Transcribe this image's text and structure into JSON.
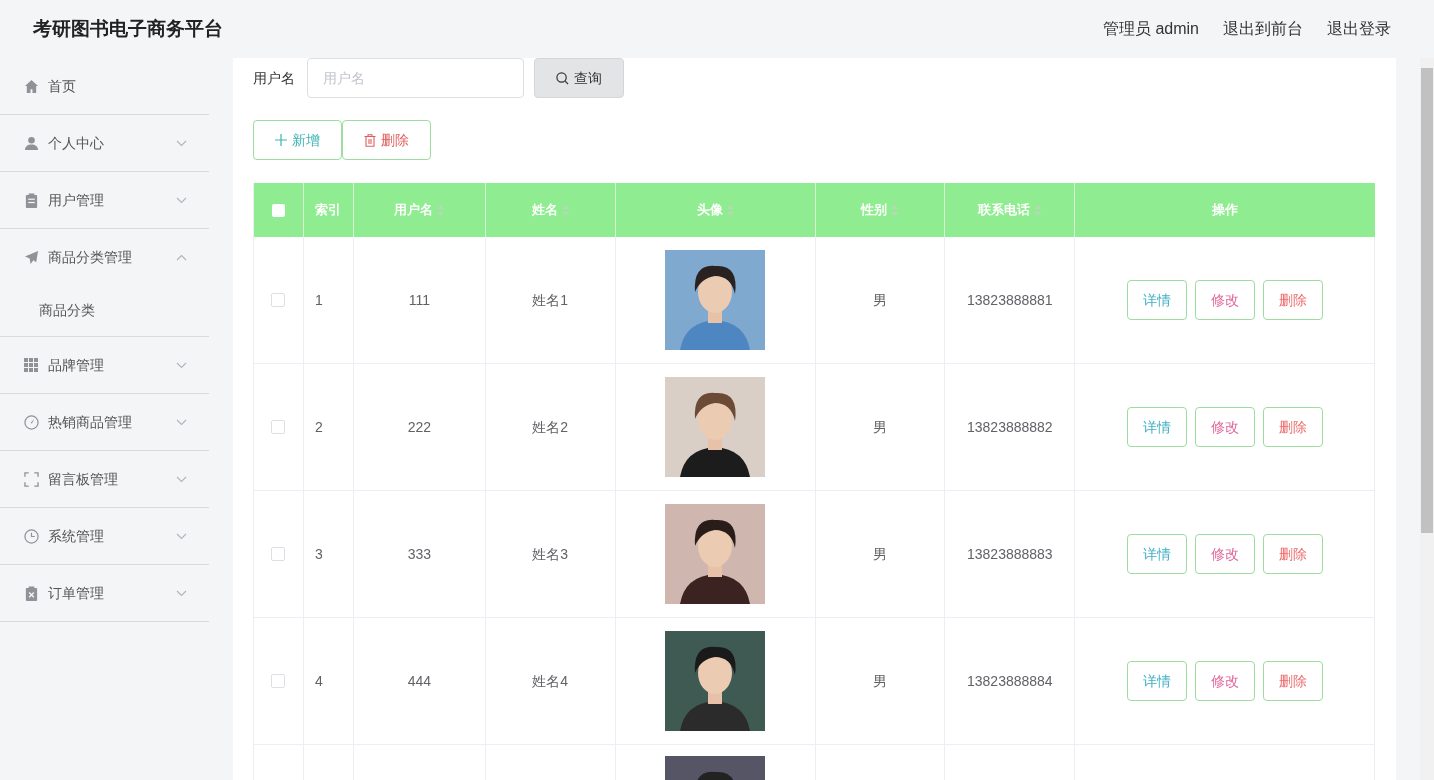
{
  "header": {
    "title": "考研图书电子商务平台",
    "links": [
      "管理员 admin",
      "退出到前台",
      "退出登录"
    ]
  },
  "sidebar": {
    "items": [
      {
        "label": "首页",
        "has_children": false
      },
      {
        "label": "个人中心",
        "expanded": false,
        "has_children": true
      },
      {
        "label": "用户管理",
        "expanded": false,
        "has_children": true
      },
      {
        "label": "商品分类管理",
        "expanded": true,
        "has_children": true,
        "children": [
          {
            "label": "商品分类"
          }
        ]
      },
      {
        "label": "品牌管理",
        "expanded": false,
        "has_children": true
      },
      {
        "label": "热销商品管理",
        "expanded": false,
        "has_children": true
      },
      {
        "label": "留言板管理",
        "expanded": false,
        "has_children": true
      },
      {
        "label": "系统管理",
        "expanded": false,
        "has_children": true
      },
      {
        "label": "订单管理",
        "expanded": false,
        "has_children": true
      }
    ]
  },
  "search": {
    "label": "用户名",
    "placeholder": "用户名",
    "button": "查询"
  },
  "actions": [
    {
      "label": "新增",
      "kind": "add"
    },
    {
      "label": "删除",
      "kind": "delete"
    }
  ],
  "table": {
    "all_checked": false,
    "columns": [
      {
        "label": "索引",
        "sortable": false
      },
      {
        "label": "用户名",
        "sortable": true
      },
      {
        "label": "姓名",
        "sortable": true
      },
      {
        "label": "头像",
        "sortable": true
      },
      {
        "label": "性别",
        "sortable": true
      },
      {
        "label": "联系电话",
        "sortable": true
      },
      {
        "label": "操作",
        "sortable": false
      }
    ],
    "rows": [
      {
        "index": "1",
        "username": "111",
        "name": "姓名1",
        "gender": "男",
        "phone": "13823888881",
        "checked": false,
        "buttons": [
          "详情",
          "修改",
          "删除"
        ]
      },
      {
        "index": "2",
        "username": "222",
        "name": "姓名2",
        "gender": "男",
        "phone": "13823888882",
        "checked": false,
        "buttons": [
          "详情",
          "修改",
          "删除"
        ]
      },
      {
        "index": "3",
        "username": "333",
        "name": "姓名3",
        "gender": "男",
        "phone": "13823888883",
        "checked": false,
        "buttons": [
          "详情",
          "修改",
          "删除"
        ]
      },
      {
        "index": "4",
        "username": "444",
        "name": "姓名4",
        "gender": "男",
        "phone": "13823888884",
        "checked": false,
        "buttons": [
          "详情",
          "修改",
          "删除"
        ]
      },
      {
        "kind": "partial"
      }
    ]
  }
}
